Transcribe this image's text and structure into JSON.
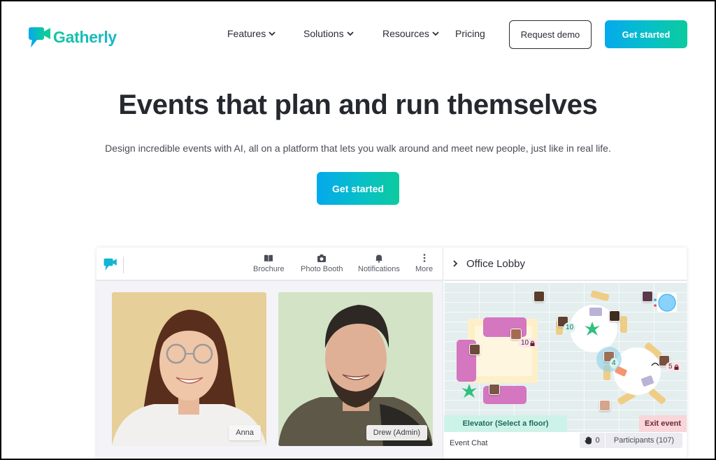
{
  "brand": {
    "name": "Gatherly",
    "accent_start": "#05a9ec",
    "accent_end": "#0ccb9d"
  },
  "nav": {
    "items": [
      {
        "label": "Features",
        "has_dropdown": true
      },
      {
        "label": "Solutions",
        "has_dropdown": true
      },
      {
        "label": "Resources",
        "has_dropdown": true
      },
      {
        "label": "Pricing",
        "has_dropdown": false
      }
    ],
    "request_demo": "Request demo",
    "get_started": "Get started"
  },
  "hero": {
    "title": "Events that plan and run themselves",
    "subtitle": "Design incredible events with AI, all on a platform that lets you walk around and meet new people, just like in real life.",
    "cta": "Get started"
  },
  "app_preview": {
    "toolbar": [
      {
        "label": "Brochure",
        "icon": "book-icon"
      },
      {
        "label": "Photo Booth",
        "icon": "camera-icon"
      },
      {
        "label": "Notifications",
        "icon": "bell-icon"
      },
      {
        "label": "More",
        "icon": "more-vertical-icon"
      }
    ],
    "video_tiles": [
      {
        "name": "Anna"
      },
      {
        "name": "Drew (Admin)"
      }
    ],
    "room": {
      "title": "Office Lobby",
      "group_counts": {
        "sofa_group": "10",
        "table_one": "10",
        "table_two_group": "4",
        "table_two_locked": "5"
      },
      "elevator_label": "Elevator (Select a floor)",
      "exit_label": "Exit event",
      "chat_label": "Event Chat",
      "raised_hands": "0",
      "participants_label": "Participants (107)"
    }
  }
}
